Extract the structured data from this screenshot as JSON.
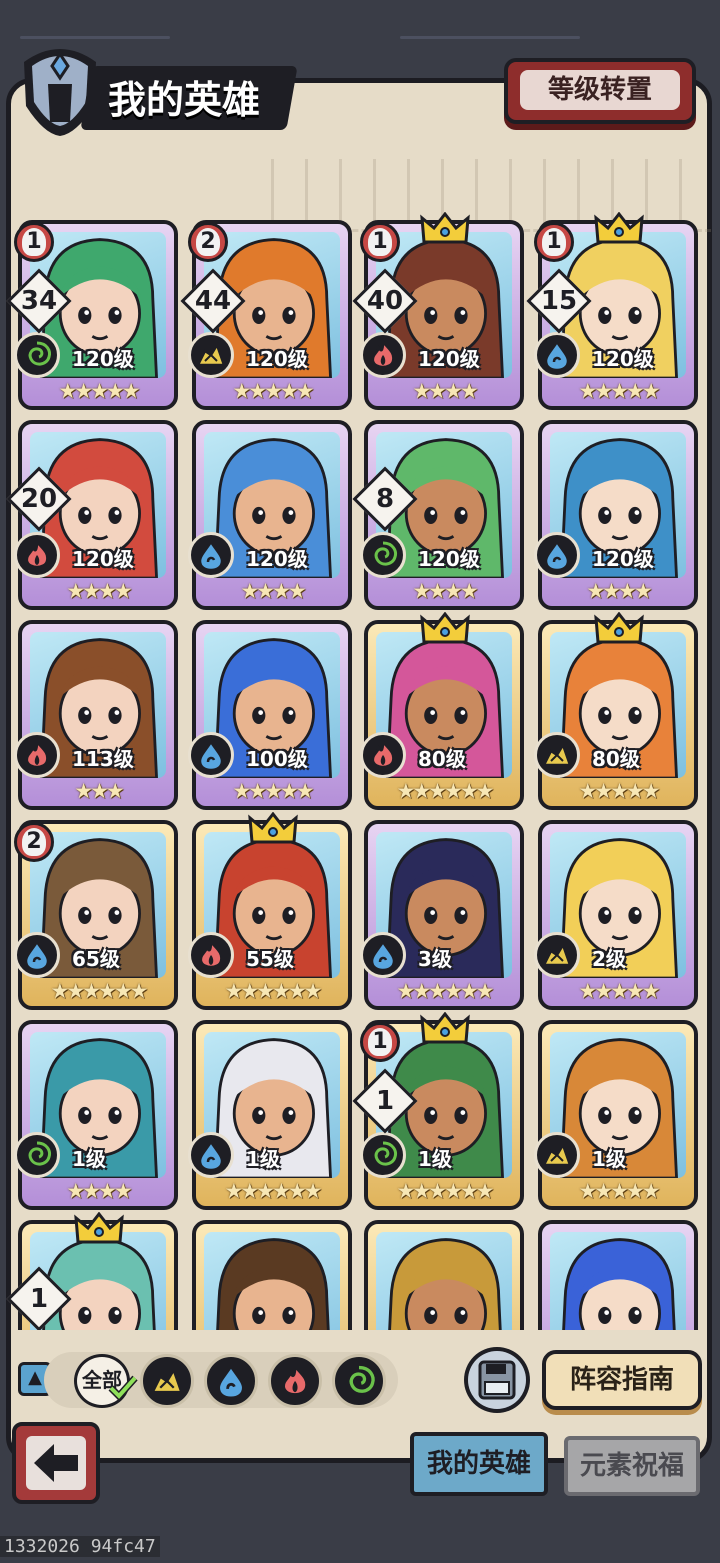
{
  "header": {
    "title": "我的英雄",
    "level_transfer_label": "等级转置"
  },
  "element_colors": {
    "wind": "#6ac24a",
    "earth": "#e7c94e",
    "fire": "#e86a6a",
    "water": "#58a6e0"
  },
  "heroes": [
    {
      "tier": "1",
      "count": "34",
      "level": "120级",
      "element": "wind",
      "stars": "★★★★★",
      "frame": "purple",
      "crown": false
    },
    {
      "tier": "2",
      "count": "44",
      "level": "120级",
      "element": "earth",
      "stars": "★★★★★",
      "frame": "purple",
      "crown": false
    },
    {
      "tier": "1",
      "count": "40",
      "level": "120级",
      "element": "fire",
      "stars": "★★★★",
      "frame": "purple",
      "crown": true
    },
    {
      "tier": "1",
      "count": "15",
      "level": "120级",
      "element": "water",
      "stars": "★★★★★",
      "frame": "purple",
      "crown": true
    },
    {
      "tier": "",
      "count": "20",
      "level": "120级",
      "element": "fire",
      "stars": "★★★★",
      "frame": "purple",
      "crown": false
    },
    {
      "tier": "",
      "count": "",
      "level": "120级",
      "element": "water",
      "stars": "★★★★",
      "frame": "purple",
      "crown": false
    },
    {
      "tier": "",
      "count": "8",
      "level": "120级",
      "element": "wind",
      "stars": "★★★★",
      "frame": "purple",
      "crown": false
    },
    {
      "tier": "",
      "count": "",
      "level": "120级",
      "element": "water",
      "stars": "★★★★",
      "frame": "purple",
      "crown": false
    },
    {
      "tier": "",
      "count": "",
      "level": "113级",
      "element": "fire",
      "stars": "★★★",
      "frame": "purple",
      "crown": false
    },
    {
      "tier": "",
      "count": "",
      "level": "100级",
      "element": "water",
      "stars": "★★★★★",
      "frame": "purple",
      "crown": false
    },
    {
      "tier": "",
      "count": "",
      "level": "80级",
      "element": "fire",
      "stars": "★★★★★★",
      "frame": "gold",
      "crown": true
    },
    {
      "tier": "",
      "count": "",
      "level": "80级",
      "element": "earth",
      "stars": "★★★★★",
      "frame": "gold",
      "crown": true
    },
    {
      "tier": "2",
      "count": "",
      "level": "65级",
      "element": "water",
      "stars": "★★★★★★",
      "frame": "gold",
      "crown": false
    },
    {
      "tier": "",
      "count": "",
      "level": "55级",
      "element": "fire",
      "stars": "★★★★★★",
      "frame": "gold",
      "crown": true
    },
    {
      "tier": "",
      "count": "",
      "level": "3级",
      "element": "water",
      "stars": "★★★★★★",
      "frame": "purple",
      "crown": false
    },
    {
      "tier": "",
      "count": "",
      "level": "2级",
      "element": "earth",
      "stars": "★★★★★",
      "frame": "purple",
      "crown": false
    },
    {
      "tier": "",
      "count": "",
      "level": "1级",
      "element": "wind",
      "stars": "★★★★",
      "frame": "purple",
      "crown": false
    },
    {
      "tier": "",
      "count": "",
      "level": "1级",
      "element": "water",
      "stars": "★★★★★★",
      "frame": "gold",
      "crown": false
    },
    {
      "tier": "1",
      "count": "1",
      "level": "1级",
      "element": "wind",
      "stars": "★★★★★★",
      "frame": "gold",
      "crown": true
    },
    {
      "tier": "",
      "count": "",
      "level": "1级",
      "element": "earth",
      "stars": "★★★★★",
      "frame": "gold",
      "crown": false
    },
    {
      "tier": "",
      "count": "1",
      "level": "",
      "element": "",
      "stars": "",
      "frame": "gold",
      "crown": true
    },
    {
      "tier": "",
      "count": "",
      "level": "",
      "element": "",
      "stars": "",
      "frame": "gold",
      "crown": false
    },
    {
      "tier": "",
      "count": "",
      "level": "",
      "element": "",
      "stars": "",
      "frame": "gold",
      "crown": false
    },
    {
      "tier": "",
      "count": "",
      "level": "",
      "element": "",
      "stars": "",
      "frame": "purple",
      "crown": false
    }
  ],
  "filters": {
    "all_label": "全部",
    "items": [
      "earth",
      "water",
      "fire",
      "wind"
    ]
  },
  "guide_label": "阵容指南",
  "tabs": {
    "my_heroes": "我的英雄",
    "element_blessing": "元素祝福"
  },
  "footer": "1332026 94fc47"
}
